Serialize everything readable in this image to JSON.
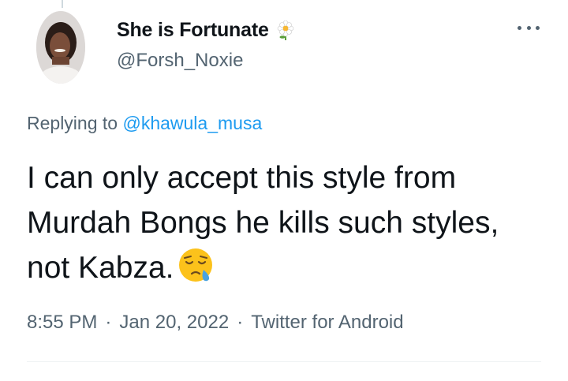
{
  "author": {
    "display_name": "She is Fortunate",
    "handle": "@Forsh_Noxie",
    "name_emoji": "flower-icon"
  },
  "reply": {
    "prefix": "Replying to",
    "mention": "@khawula_musa"
  },
  "tweet": {
    "text": "I can only accept this style from Murdah Bongs he kills such styles, not Kabza.",
    "emoji": "sleepy-face-icon"
  },
  "meta": {
    "time": "8:55 PM",
    "date": "Jan 20, 2022",
    "source": "Twitter for Android",
    "separator": "·"
  },
  "colors": {
    "link": "#1d9bf0",
    "secondary_text": "#536471",
    "primary_text": "#0f1419"
  }
}
